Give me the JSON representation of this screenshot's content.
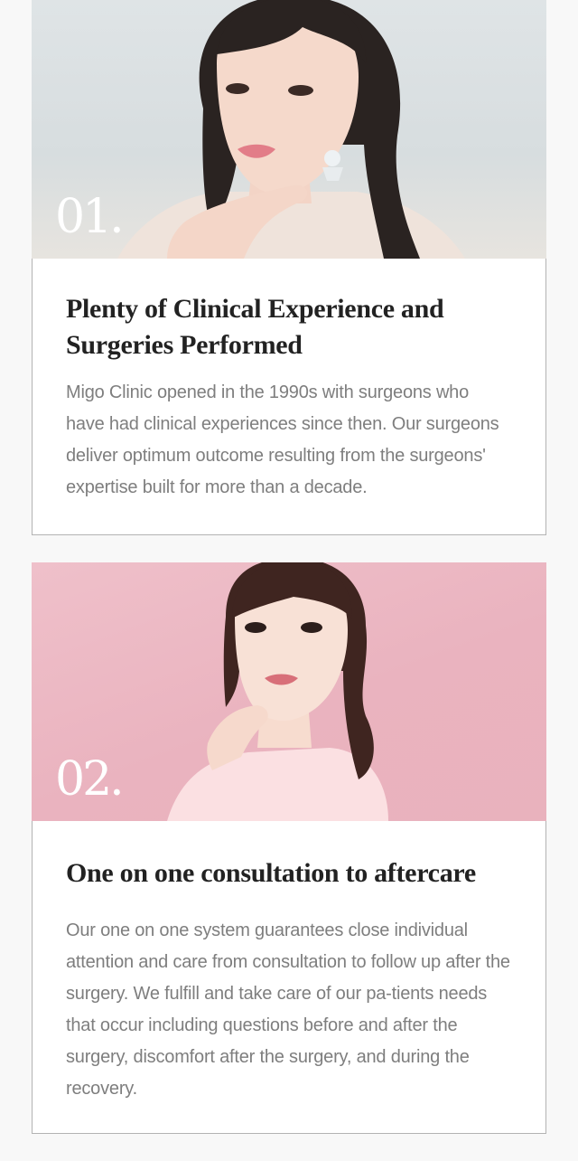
{
  "features": [
    {
      "number": "01.",
      "image_icon": "portrait-photo",
      "title": "Plenty of  Clinical Experience and Surgeries Performed",
      "description": "Migo Clinic opened in the 1990s with surgeons who have had clinical experiences since then. Our surgeons deliver optimum outcome resulting from the surgeons' expertise built for more than a decade."
    },
    {
      "number": "02.",
      "image_icon": "portrait-photo",
      "title": "One on one consultation to aftercare",
      "description": "Our one on one system guarantees close individual attention and care from consultation to follow up after the surgery. We fulfill and take care of our pa-tients needs that occur including questions before and after the surgery, discomfort after the surgery, and during the recovery."
    }
  ],
  "colors": {
    "page_background": "#f8f8f8",
    "card_border": "#b3b3b3",
    "title_text": "#222222",
    "body_text": "#7e7e7e",
    "photo_1_background": "#dfe4e6",
    "photo_2_background": "#eab3bf"
  }
}
